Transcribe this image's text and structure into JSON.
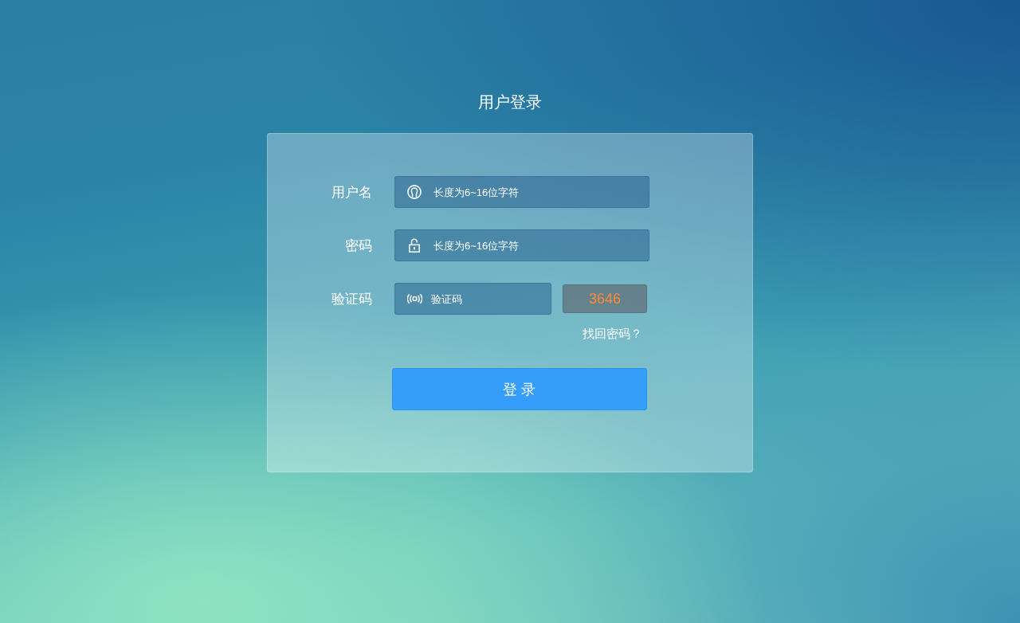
{
  "title": "用户登录",
  "form": {
    "fields": [
      {
        "label": "用户名",
        "kind": "user",
        "placeholder": "长度为6~16位字符"
      },
      {
        "label": "密码",
        "kind": "password",
        "placeholder": "长度为6~16位字符"
      },
      {
        "label": "验证码",
        "kind": "captcha",
        "placeholder": "验证码",
        "captcha_code": "3646"
      }
    ],
    "forgot_link": "找回密码？",
    "submit_button": "登 录"
  }
}
